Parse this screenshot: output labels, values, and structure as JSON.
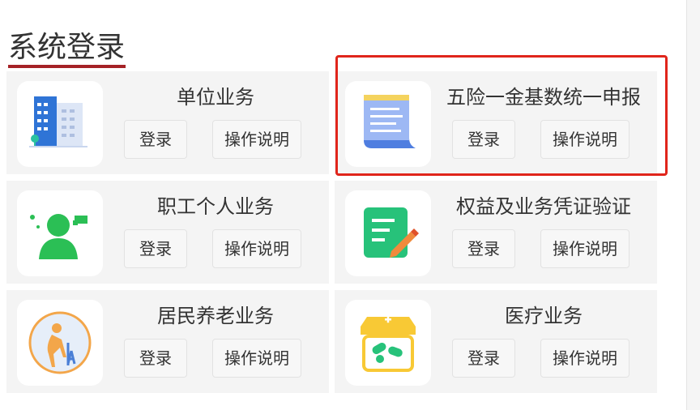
{
  "page": {
    "title": "系统登录"
  },
  "colors": {
    "title_underline": "#a52226",
    "highlight_border": "#e0251b",
    "card_bg": "#f4f4f4"
  },
  "cards": [
    {
      "name": "单位业务",
      "icon": "office-building-icon",
      "login_label": "登录",
      "help_label": "操作说明"
    },
    {
      "name": "五险一金基数统一申报",
      "icon": "document-scroll-icon",
      "login_label": "登录",
      "help_label": "操作说明",
      "highlighted": true
    },
    {
      "name": "职工个人业务",
      "icon": "person-chat-icon",
      "login_label": "登录",
      "help_label": "操作说明"
    },
    {
      "name": "权益及业务凭证验证",
      "icon": "note-pencil-icon",
      "login_label": "登录",
      "help_label": "操作说明"
    },
    {
      "name": "居民养老业务",
      "icon": "elderly-care-icon",
      "login_label": "登录",
      "help_label": "操作说明"
    },
    {
      "name": "医疗业务",
      "icon": "pharmacy-icon",
      "login_label": "登录",
      "help_label": "操作说明"
    }
  ]
}
